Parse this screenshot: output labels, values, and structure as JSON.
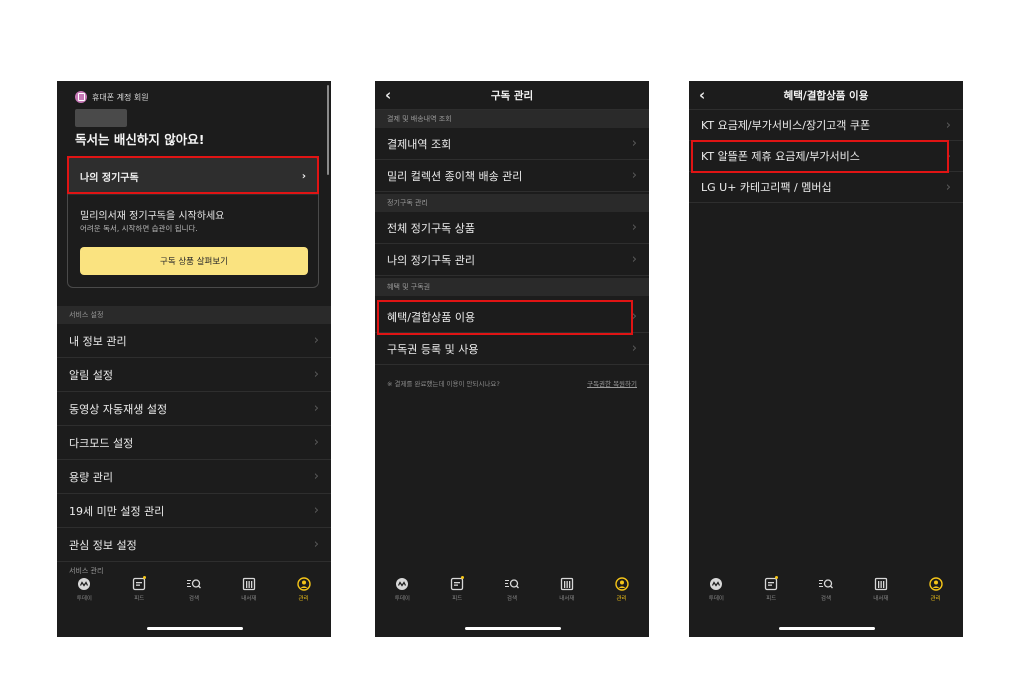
{
  "colors": {
    "accent": "#f5c518",
    "highlight": "#e01414",
    "button": "#fae380",
    "background": "#1c1c1c"
  },
  "nav": [
    {
      "label": "투데이",
      "icon": "today-icon"
    },
    {
      "label": "피드",
      "icon": "feed-icon"
    },
    {
      "label": "검색",
      "icon": "search-icon"
    },
    {
      "label": "내서재",
      "icon": "library-icon"
    },
    {
      "label": "관리",
      "icon": "profile-icon"
    }
  ],
  "screen1": {
    "account_type": "휴대폰 계정 회원",
    "headline": "독서는 배신하지 않아요!",
    "subscription_label": "나의 정기구독",
    "promo_title": "밀리의서재 정기구독을 시작하세요",
    "promo_sub": "어려운 독서, 시작하면 습관이 됩니다.",
    "promo_button": "구독 상품 살펴보기",
    "section_service": "서비스 설정",
    "items": [
      "내 정보 관리",
      "알림 설정",
      "동영상 자동재생 설정",
      "다크모드 설정",
      "용량 관리",
      "19세 미만 설정 관리",
      "관심 정보 설정"
    ],
    "section_service2": "서비스 관리"
  },
  "screen2": {
    "title": "구독 관리",
    "section1": "결제 및 배송내역 조회",
    "items1": [
      "결제내역 조회",
      "밀리 컬렉션 종이책 배송 관리"
    ],
    "section2": "정기구독 관리",
    "items2": [
      "전체 정기구독 상품",
      "나의 정기구독 관리"
    ],
    "section3": "혜택 및 구독권",
    "items3": [
      "혜택/결합상품 이용",
      "구독권 등록 및 사용"
    ],
    "note": "※ 결제를 완료했는데 이용이 안되시나요?",
    "note_link": "구독권한 복원하기"
  },
  "screen3": {
    "title": "혜택/결합상품 이용",
    "items": [
      "KT 요금제/부가서비스/장기고객 쿠폰",
      "KT 알뜰폰 제휴 요금제/부가서비스",
      "LG U+ 카테고리팩 / 멤버십"
    ]
  }
}
